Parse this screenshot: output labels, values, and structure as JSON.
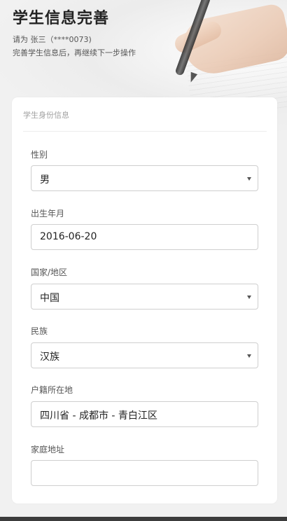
{
  "header": {
    "title": "学生信息完善",
    "greeting": "请为 张三（****0073)",
    "instruction": "完善学生信息后，再继续下一步操作"
  },
  "card": {
    "section_title": "学生身份信息",
    "fields": [
      {
        "label": "性别",
        "value": "男",
        "type": "select"
      },
      {
        "label": "出生年月",
        "value": "2016-06-20",
        "type": "date"
      },
      {
        "label": "国家/地区",
        "value": "中国",
        "type": "select"
      },
      {
        "label": "民族",
        "value": "汉族",
        "type": "select"
      },
      {
        "label": "户籍所在地",
        "value": "四川省 - 成都市 - 青白江区",
        "type": "region"
      },
      {
        "label": "家庭地址",
        "value": "",
        "type": "text"
      }
    ]
  },
  "icons": {
    "dropdown": "chevron-down-icon"
  }
}
